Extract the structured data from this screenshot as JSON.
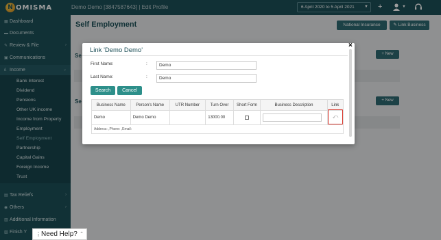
{
  "topbar": {
    "logo_letter": "N",
    "logo_text": "OMISMA",
    "client": "Demo Demo [3847587643]",
    "client_sep": " | ",
    "edit_profile": "Edit Profile",
    "date_range": "6 April 2020 to 5 April 2021",
    "icons": [
      "plus-icon",
      "user-icon",
      "headset-icon"
    ]
  },
  "sidebar": {
    "items": [
      {
        "label": "Dashboard",
        "icon": "dashboard-icon"
      },
      {
        "label": "Documents",
        "icon": "folder-icon"
      },
      {
        "label": "Review & File",
        "icon": "edit-icon"
      },
      {
        "label": "Communications",
        "icon": "mail-icon"
      },
      {
        "label": "Income",
        "icon": "pound-icon"
      }
    ],
    "income_sub": [
      "Bank Interest",
      "Dividend",
      "Pensions",
      "Other UK income",
      "Income from Property",
      "Employment",
      "Self Employment",
      "Partnership",
      "Capital Gains",
      "Foreign Income",
      "Trust"
    ],
    "bottom_items": [
      {
        "label": "Tax Reliefs",
        "icon": "relief-icon"
      },
      {
        "label": "Others",
        "icon": "others-icon"
      },
      {
        "label": "Additional Information",
        "icon": "info-icon"
      },
      {
        "label": "Finish Y",
        "icon": "finish-icon"
      }
    ]
  },
  "main": {
    "title": "Self Employment",
    "national_insurance": "National Insurance",
    "link_business": "Link Business",
    "new_label": "New"
  },
  "modal": {
    "title": "Link 'Demo Demo'",
    "first_name_label": "First Name:",
    "last_name_label": "Last Name:",
    "colon": ":",
    "first_name_value": "Demo",
    "last_name_value": "Demo",
    "search": "Search",
    "cancel": "Cancel",
    "close": "×",
    "columns": [
      "Business Name",
      "Person's Name",
      "UTR Number",
      "Turn Over",
      "Short Form",
      "Business Description",
      "Link"
    ],
    "row": {
      "business_name": "Demo",
      "person_name": "Demo Demo",
      "utr": "",
      "turnover": "13000.00",
      "short_form": false,
      "description": ""
    },
    "address_line": "Address: ,Phone: ,Email:"
  },
  "help": {
    "label": "Need Help?"
  }
}
